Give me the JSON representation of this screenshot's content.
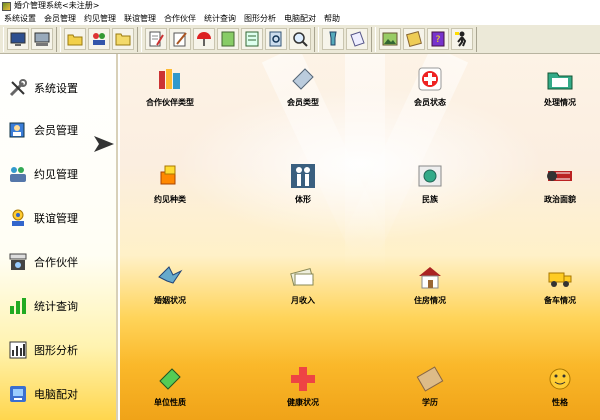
{
  "window": {
    "title": "婚介管理系统<未注册>"
  },
  "menu": [
    "系统设置",
    "会员管理",
    "约见管理",
    "联谊管理",
    "合作伙伴",
    "统计查询",
    "图形分析",
    "电脑配对",
    "帮助"
  ],
  "toolbar": {
    "buttons": [
      "monitor-icon",
      "display-icon",
      "folder-open-icon",
      "people-icon",
      "folder-icon",
      "document-pen-icon",
      "pen-write-icon",
      "umbrella-icon",
      "notes-icon",
      "notebook-icon",
      "search-doc-icon",
      "magnifier-icon",
      "flashlight-icon",
      "note-paper-icon",
      "picture-frame-icon",
      "book-icon",
      "help-book-icon",
      "exit-person-icon"
    ]
  },
  "sidebar": {
    "items": [
      {
        "label": "系统设置",
        "icon": "tools-icon",
        "selected": true
      },
      {
        "label": "会员管理",
        "icon": "member-card-icon"
      },
      {
        "label": "约见管理",
        "icon": "meeting-icon"
      },
      {
        "label": "联谊管理",
        "icon": "party-icon"
      },
      {
        "label": "合作伙伴",
        "icon": "partner-icon"
      },
      {
        "label": "统计查询",
        "icon": "statistics-icon"
      },
      {
        "label": "图形分析",
        "icon": "chart-analysis-icon"
      },
      {
        "label": "电脑配对",
        "icon": "computer-match-icon"
      }
    ]
  },
  "main": {
    "items": [
      {
        "label": "合作伙伴类型",
        "icon": "books-icon"
      },
      {
        "label": "会员类型",
        "icon": "document-icon"
      },
      {
        "label": "会员状态",
        "icon": "first-aid-icon"
      },
      {
        "label": "处理情况",
        "icon": "folder-plus-icon"
      },
      {
        "label": "约见种类",
        "icon": "puzzle-icon"
      },
      {
        "label": "体形",
        "icon": "people-figure-icon"
      },
      {
        "label": "民族",
        "icon": "globe-folder-icon"
      },
      {
        "label": "政治面貌",
        "icon": "film-roll-icon"
      },
      {
        "label": "婚姻状况",
        "icon": "bird-icon"
      },
      {
        "label": "月收入",
        "icon": "money-icon"
      },
      {
        "label": "住房情况",
        "icon": "house-icon"
      },
      {
        "label": "备车情况",
        "icon": "truck-icon"
      },
      {
        "label": "单位性质",
        "icon": "building-icon"
      },
      {
        "label": "健康状况",
        "icon": "red-cross-icon"
      },
      {
        "label": "学历",
        "icon": "diploma-icon"
      },
      {
        "label": "性格",
        "icon": "smiley-thumb-icon"
      }
    ]
  },
  "colors": {
    "toolbar_bg": "#ece9d8",
    "gradient_bottom": "#f0a318",
    "sidebar_bottom": "#ffd64d"
  }
}
